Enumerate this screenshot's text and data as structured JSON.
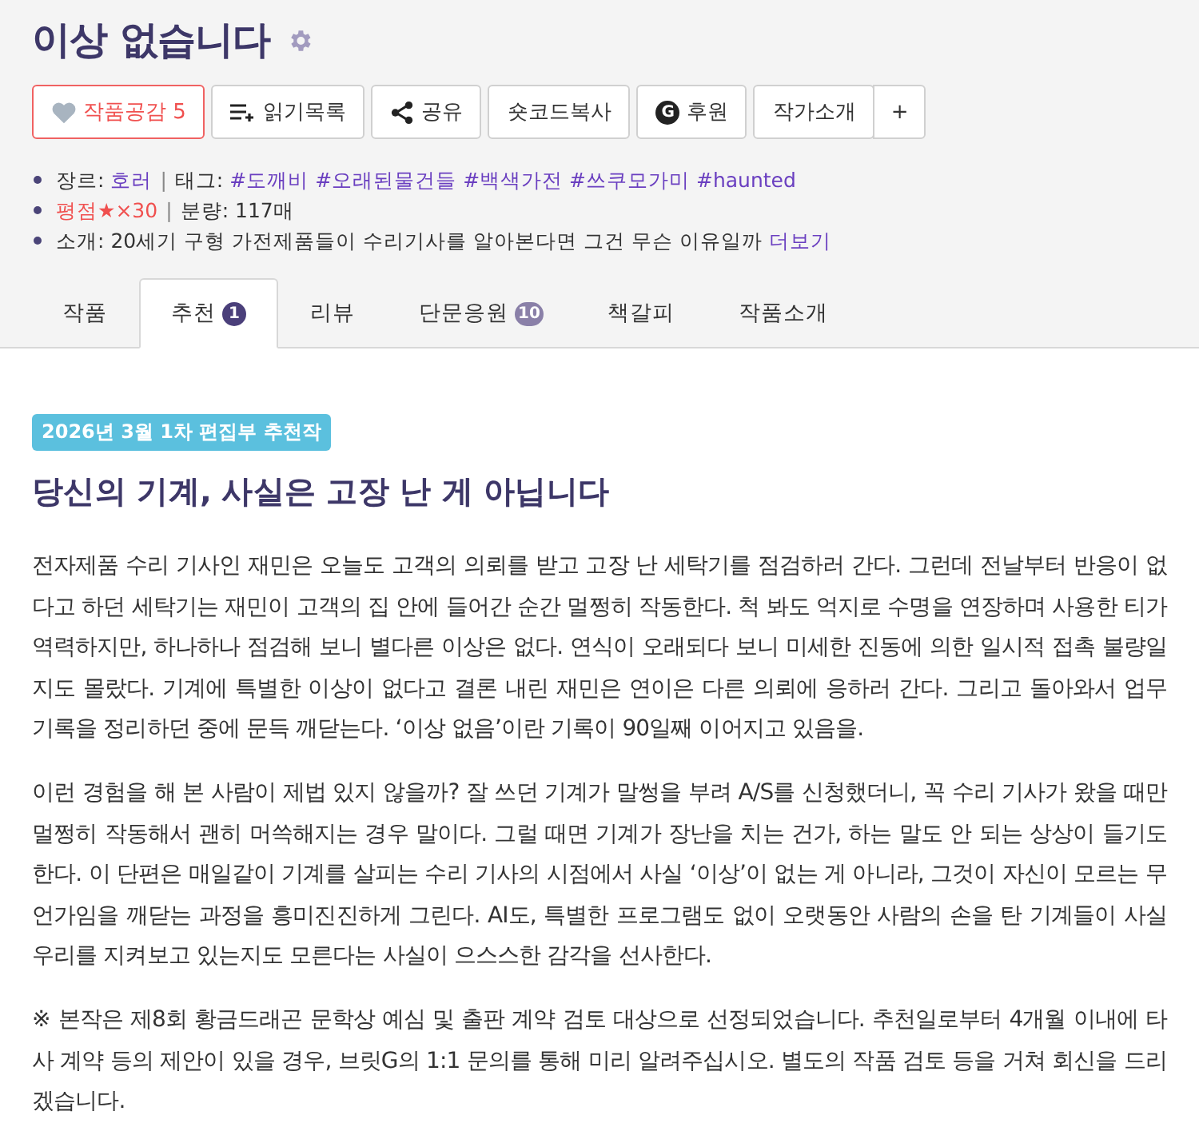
{
  "title": "이상 없습니다",
  "buttons": [
    {
      "kind": "like",
      "label": "작품공감 5"
    },
    {
      "kind": "list",
      "label": "읽기목록"
    },
    {
      "kind": "share",
      "label": "공유"
    },
    {
      "kind": "plain",
      "label": "숏코드복사"
    },
    {
      "kind": "sponsor",
      "label": "후원",
      "icon_text": "G"
    },
    {
      "kind": "plain",
      "label": "작가소개"
    },
    {
      "kind": "more",
      "label": "+"
    }
  ],
  "info": {
    "genre_label": "장르:",
    "genre": "호러",
    "separator": "|",
    "tags_label": "태그:",
    "tags": [
      "#도깨비",
      "#오래된물건들",
      "#백색가전",
      "#쓰쿠모가미",
      "#haunted"
    ],
    "rating": "평점★×30",
    "length": "분량: 117매",
    "intro_label": "소개:",
    "intro": "20세기 구형 가전제품들이 수리기사를 알아본다면 그건 무슨 이유일까",
    "more": "더보기"
  },
  "tabs": [
    {
      "label": "작품",
      "selected": false
    },
    {
      "label": "추천",
      "badge": "1",
      "selected": true
    },
    {
      "label": "리뷰",
      "selected": false
    },
    {
      "label": "단문응원",
      "badge": "10",
      "selected": false
    },
    {
      "label": "책갈피",
      "selected": false
    },
    {
      "label": "작품소개",
      "selected": false
    }
  ],
  "recommendation": {
    "badge": "2026년 3월 1차 편집부 추천작",
    "heading": "당신의 기계, 사실은 고장 난 게 아닙니다",
    "paragraphs": [
      "전자제품 수리 기사인 재민은 오늘도 고객의 의뢰를 받고 고장 난 세탁기를 점검하러 간다. 그런데 전날부터 반응이 없다고 하던 세탁기는 재민이 고객의 집 안에 들어간 순간 멀쩡히 작동한다. 척 봐도 억지로 수명을 연장하며 사용한 티가 역력하지만, 하나하나 점검해 보니 별다른 이상은 없다. 연식이 오래되다 보니 미세한 진동에 의한 일시적 접촉 불량일지도 몰랐다. 기계에 특별한 이상이 없다고 결론 내린 재민은 연이은 다른 의뢰에 응하러 간다. 그리고 돌아와서 업무 기록을 정리하던 중에 문득 깨닫는다. ‘이상 없음’이란 기록이 90일째 이어지고 있음을.",
      "이런 경험을 해 본 사람이 제법 있지 않을까? 잘 쓰던 기계가 말썽을 부려 A/S를 신청했더니, 꼭 수리 기사가 왔을 때만 멀쩡히 작동해서 괜히 머쓱해지는 경우 말이다. 그럴 때면 기계가 장난을 치는 건가, 하는 말도 안 되는 상상이 들기도 한다. 이 단편은 매일같이 기계를 살피는 수리 기사의 시점에서 사실 ‘이상’이 없는 게 아니라, 그것이 자신이 모르는 무언가임을 깨닫는 과정을 흥미진진하게 그린다. AI도, 특별한 프로그램도 없이 오랫동안 사람의 손을 탄 기계들이 사실 우리를 지켜보고 있는지도 모른다는 사실이 으스스한 감각을 선사한다.",
      "※ 본작은 제8회 황금드래곤 문학상 예심 및 출판 계약 검토 대상으로 선정되었습니다. 추천일로부터 4개월 이내에 타사 계약 등의 제안이 있을 경우, 브릿G의 1:1 문의를 통해 미리 알려주십시오. 별도의 작품 검토 등을 거쳐 회신을 드리겠습니다."
    ]
  }
}
